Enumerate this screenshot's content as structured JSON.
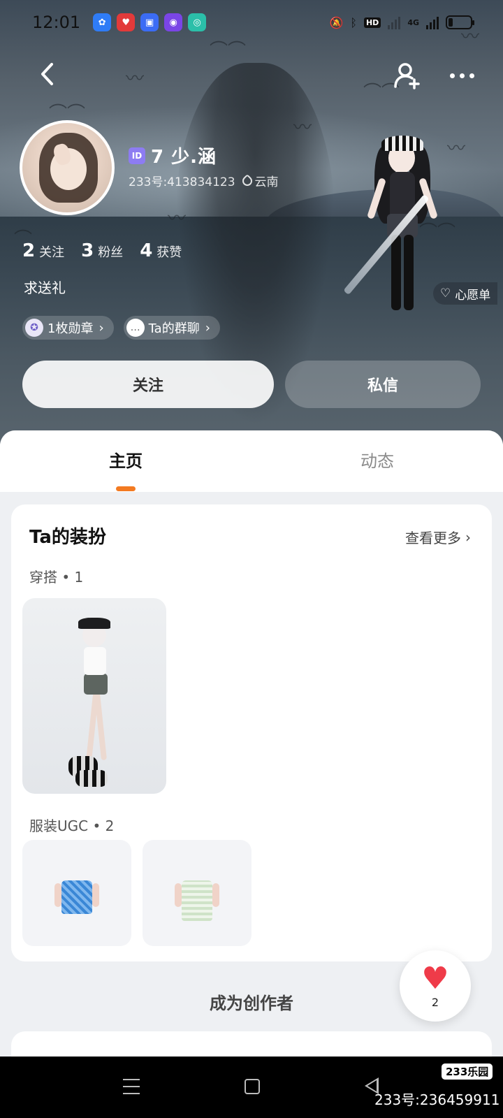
{
  "status_bar": {
    "time": "12:01",
    "app_icons": [
      {
        "name": "baidu-app-icon",
        "color": "#2f7cf6",
        "glyph": "⚘"
      },
      {
        "name": "gift-app-icon",
        "color": "#e23a3a",
        "glyph": "♥"
      },
      {
        "name": "chat-app-icon",
        "color": "#3b6cf5",
        "glyph": "▣"
      },
      {
        "name": "purple-app-icon",
        "color": "#7a45e6",
        "glyph": "◉"
      },
      {
        "name": "teal-app-icon",
        "color": "#2bbfa9",
        "glyph": "◎"
      }
    ],
    "hd_label": "HD",
    "network_label": "4G"
  },
  "profile": {
    "username": "7 少.涵",
    "id_badge": "ID",
    "account_id": "233号:413834123",
    "location": "云南",
    "stats": [
      {
        "num": "2",
        "label": "关注"
      },
      {
        "num": "3",
        "label": "粉丝"
      },
      {
        "num": "4",
        "label": "获赞"
      }
    ],
    "bio": "求送礼",
    "chips": [
      {
        "label": "1枚勋章",
        "icon": "medal-icon"
      },
      {
        "label": "Ta的群聊",
        "icon": "group-chat-icon"
      }
    ],
    "wishlist_label": "心愿单",
    "follow_label": "关注",
    "message_label": "私信"
  },
  "tabs": [
    {
      "label": "主页",
      "active": true
    },
    {
      "label": "动态",
      "active": false
    }
  ],
  "dress_section": {
    "title": "Ta的装扮",
    "see_more": "查看更多",
    "outfits_label": "穿搭 • 1",
    "ugc_label": "服装UGC • 2"
  },
  "creator_label": "成为创作者",
  "like_count": "2",
  "watermark": {
    "logo": "233乐园",
    "id": "233号:236459911"
  },
  "colors": {
    "accent": "#f37a21",
    "like": "#ef3b49",
    "id_badge": "#8d7cf2"
  }
}
